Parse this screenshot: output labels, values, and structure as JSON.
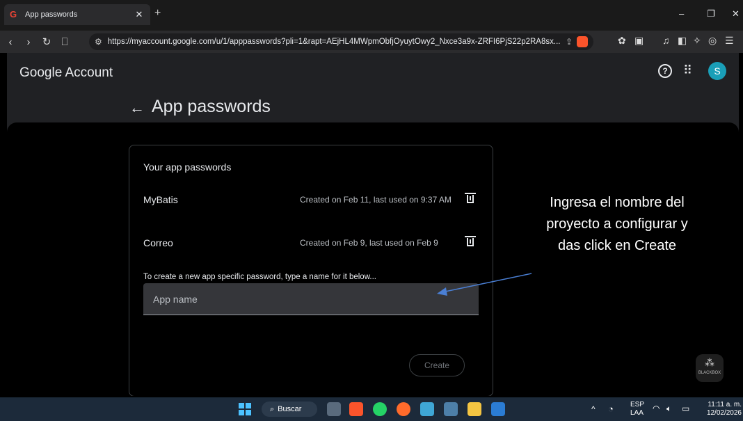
{
  "browser": {
    "tab_title": "App passwords",
    "tab_favicon": "G",
    "new_tab": "+",
    "url": "https://myaccount.google.com/u/1/apppasswords?pli=1&rapt=AEjHL4MWpmObfjOyuytOwy2_Nxce3a9x-ZRFI6PjS22p2RA8sx...",
    "window_controls": [
      "–",
      "❐",
      "✕"
    ]
  },
  "header": {
    "logo": "Google Account",
    "avatar_letter": "S"
  },
  "page": {
    "title": "App passwords",
    "card_heading": "Your app passwords",
    "passwords": [
      {
        "name": "MyBatis",
        "meta": "Created on Feb 11, last used on 9:37 AM"
      },
      {
        "name": "Correo",
        "meta": "Created on Feb 9, last used on Feb 9"
      }
    ],
    "hint": "To create a new app specific password, type a name for it below...",
    "input_placeholder": "App name",
    "create_label": "Create"
  },
  "annotation": {
    "lines": [
      "Ingresa el nombre del",
      "proyecto a configurar y",
      "das click en Create"
    ],
    "arrow_color": "#4a7fd4"
  },
  "overlay": {
    "blackbox_label": "BLACKBOX"
  },
  "taskbar": {
    "search_label": "Buscar",
    "lang_top": "ESP",
    "lang_bottom": "LAA",
    "time": "11:11 a. m.",
    "date": "12/02/2026"
  }
}
